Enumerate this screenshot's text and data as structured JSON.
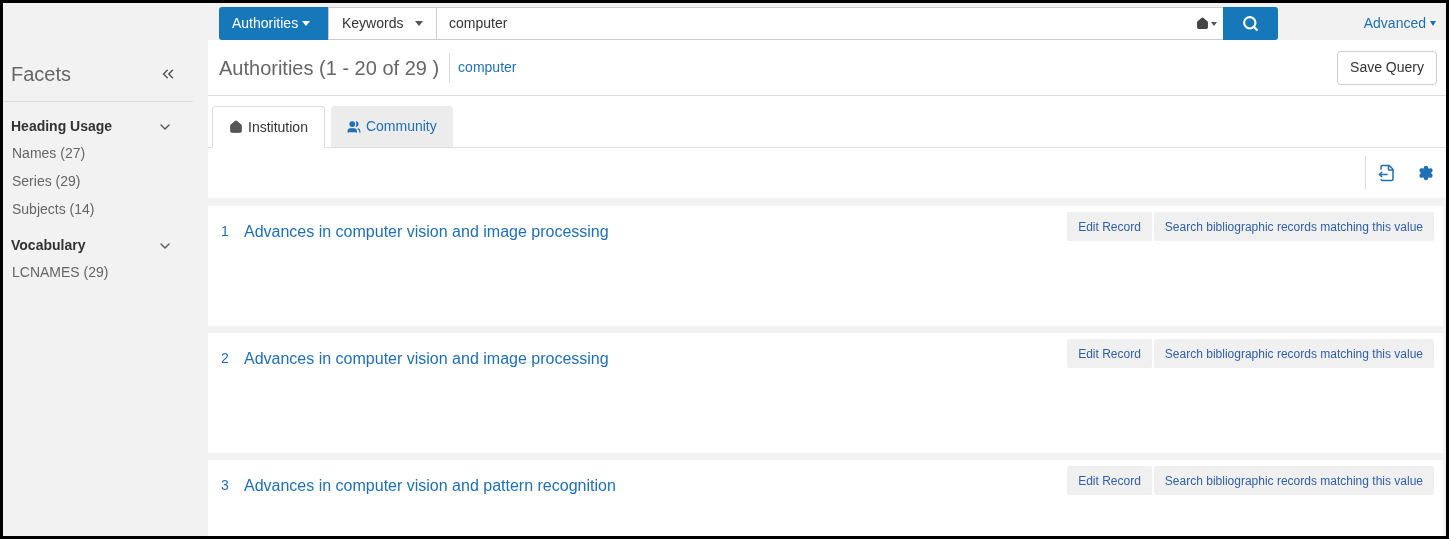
{
  "search": {
    "scope": "Authorities",
    "field": "Keywords",
    "query": "computer",
    "advanced": "Advanced"
  },
  "sidebar": {
    "title": "Facets",
    "groups": [
      {
        "title": "Heading Usage",
        "expanded": true,
        "items": [
          "Names (27)",
          "Series (29)",
          "Subjects (14)"
        ]
      },
      {
        "title": "Vocabulary",
        "expanded": true,
        "items": [
          "LCNAMES (29)"
        ]
      }
    ]
  },
  "results_header": {
    "title": "Authorities (1 - 20 of 29 )",
    "query": "computer",
    "save_button": "Save Query"
  },
  "tabs": [
    {
      "label": "Institution",
      "selected": true
    },
    {
      "label": "Community",
      "selected": false
    }
  ],
  "results": [
    {
      "number": "1",
      "title": "Advances in computer vision and image processing",
      "actions": [
        "Edit Record",
        "Search bibliographic records matching this value"
      ]
    },
    {
      "number": "2",
      "title": "Advances in computer vision and image processing",
      "actions": [
        "Edit Record",
        "Search bibliographic records matching this value"
      ]
    },
    {
      "number": "3",
      "title": "Advances in computer vision and pattern recognition",
      "actions": [
        "Edit Record",
        "Search bibliographic records matching this value"
      ]
    }
  ]
}
